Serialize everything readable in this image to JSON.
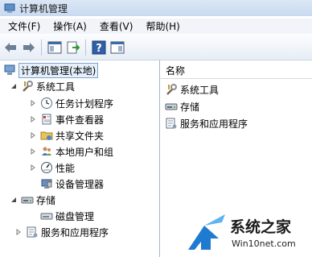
{
  "window": {
    "title": "计算机管理"
  },
  "menu": [
    {
      "label": "文件(F)"
    },
    {
      "label": "操作(A)"
    },
    {
      "label": "查看(V)"
    },
    {
      "label": "帮助(H)"
    }
  ],
  "toolbar": {
    "icons": [
      "back-arrow-icon",
      "forward-arrow-icon",
      "show-hide-tree-icon",
      "export-list-icon",
      "help-icon",
      "properties-icon"
    ],
    "help_glyph": "?"
  },
  "tree": {
    "root": "计算机管理(本地)",
    "system_tools": "系统工具",
    "children": [
      {
        "label": "任务计划程序"
      },
      {
        "label": "事件查看器"
      },
      {
        "label": "共享文件夹"
      },
      {
        "label": "本地用户和组"
      },
      {
        "label": "性能"
      },
      {
        "label": "设备管理器"
      }
    ],
    "storage": "存储",
    "disk": "磁盘管理",
    "services": "服务和应用程序"
  },
  "list": {
    "header": "名称",
    "items": [
      {
        "label": "系统工具"
      },
      {
        "label": "存储"
      },
      {
        "label": "服务和应用程序"
      }
    ]
  },
  "watermark": {
    "brand": "系统之家",
    "site": "Win10net.com"
  },
  "colors": {
    "accent": "#1f7bd0",
    "title_bar": "#cfdef2"
  }
}
